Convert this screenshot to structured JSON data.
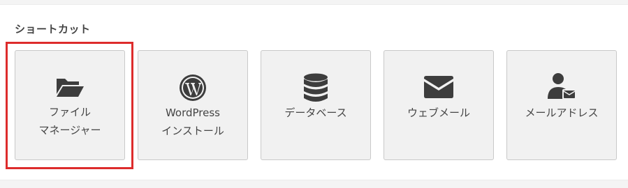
{
  "section": {
    "title": "ショートカット"
  },
  "tiles": [
    {
      "line1": "ファイル",
      "line2": "マネージャー",
      "icon": "folder-open-icon"
    },
    {
      "line1": "WordPress",
      "line2": "インストール",
      "icon": "wordpress-icon"
    },
    {
      "line1": "データベース",
      "line2": "",
      "icon": "database-icon"
    },
    {
      "line1": "ウェブメール",
      "line2": "",
      "icon": "envelope-icon"
    },
    {
      "line1": "メールアドレス",
      "line2": "",
      "icon": "mail-user-icon"
    }
  ],
  "colors": {
    "icon": "#3d3d3d",
    "tile_bg": "#f1f1f1",
    "tile_border": "#c9c9c9",
    "highlight": "#dd2c2c"
  }
}
